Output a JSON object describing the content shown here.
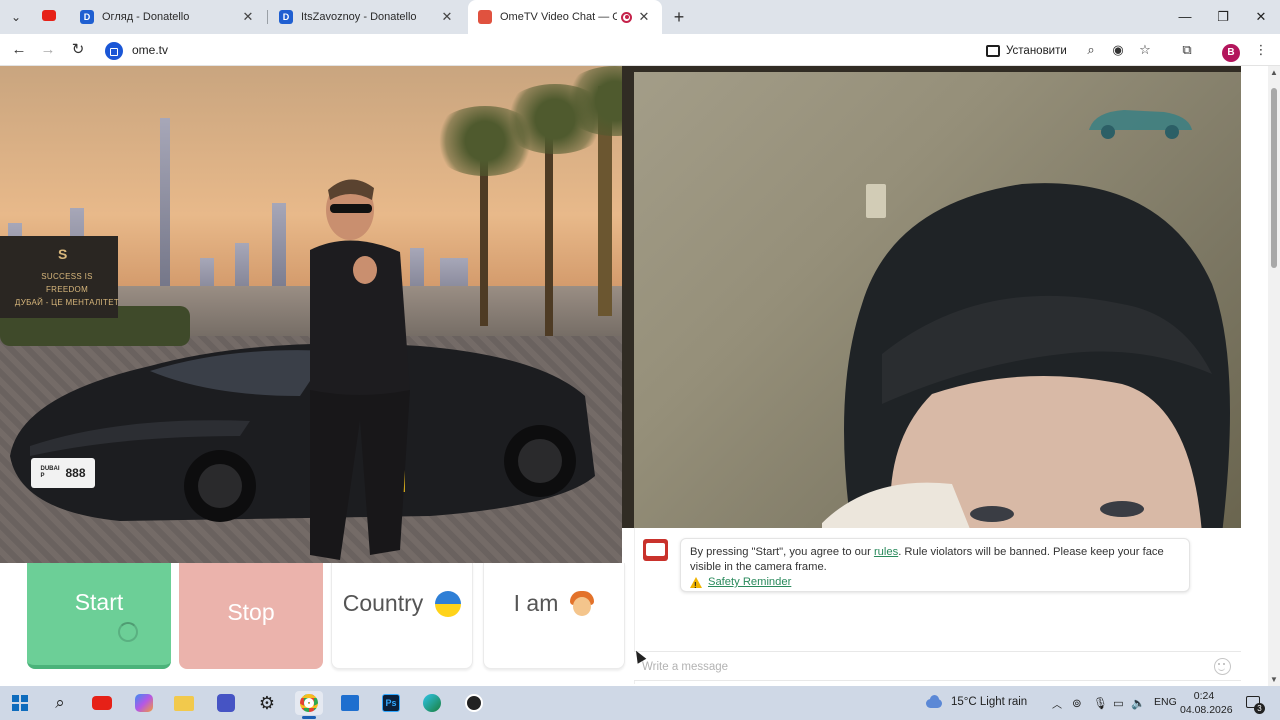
{
  "browser": {
    "tabs": [
      {
        "title": "Огляд - Donatello",
        "favicon": "donatello-d-icon"
      },
      {
        "title": "ItsZavoznoy - Donatello",
        "favicon": "donatello-d-icon"
      },
      {
        "title": "OmeTV Video Chat — Ome",
        "favicon": "ometv-icon"
      }
    ],
    "url": "ome.tv",
    "install_label": "Установити",
    "profile_letter": "B"
  },
  "left_video": {
    "sign_lines": [
      "SUCCESS IS",
      "FREEDOM",
      "ДУБАЙ - ЦЕ МЕНТАЛІТЕТ"
    ],
    "sign_logo": "S",
    "plate_number": "888",
    "plate_small": "DUBAI\nP"
  },
  "notice": {
    "text_before": "By pressing \"Start\", you agree to our ",
    "rules_link": "rules",
    "text_after": ". Rule violators will be banned. Please keep your face visible in the camera frame.",
    "safety_link": "Safety Reminder"
  },
  "chat": {
    "placeholder": "Write a message"
  },
  "controls": {
    "start": "Start",
    "stop": "Stop",
    "country": "Country",
    "iam": "I am"
  },
  "taskbar": {
    "weather": "15°C  Light rain",
    "language": "ENG",
    "time": "0:24",
    "date": "04.08.2026",
    "notification_count": "3"
  },
  "colors": {
    "start_green": "#6ccf97",
    "stop_pink": "#ebb3ac",
    "link_green": "#2a8a5c"
  }
}
